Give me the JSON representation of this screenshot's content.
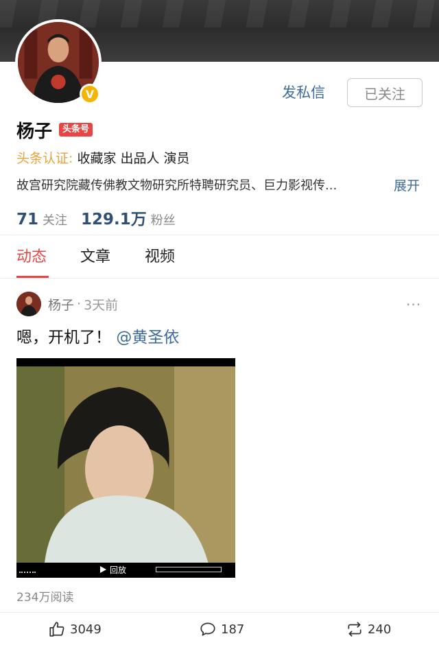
{
  "profile": {
    "name": "杨子",
    "badge": "头条号",
    "message_label": "发私信",
    "follow_label": "已关注",
    "verified_mark": "V",
    "cert_label": "头条认证:",
    "cert_value": "收藏家 出品人 演员",
    "bio": "故宫研究院藏传佛教文物研究所特聘研究员、巨力影视传...",
    "expand_label": "展开",
    "following_count": "71",
    "following_label": "关注",
    "fans_count": "129.1万",
    "fans_label": "粉丝"
  },
  "tabs": [
    {
      "label": "动态",
      "active": true
    },
    {
      "label": "文章",
      "active": false
    },
    {
      "label": "视频",
      "active": false
    }
  ],
  "post": {
    "author": "杨子",
    "separator": "·",
    "time": "3天前",
    "more": "···",
    "text": "嗯，开机了！",
    "mention": "@黄圣依",
    "video_control_label": "回放",
    "reads": "234万阅读",
    "likes": "3049",
    "comments": "187",
    "reposts": "240"
  },
  "colors": {
    "accent_red": "#e84545",
    "link_blue": "#3d6b9b",
    "cert_orange": "#e8a33a",
    "verified_gold": "#f4b400"
  },
  "icons": [
    "thumbs-up-icon",
    "comment-icon",
    "repost-icon",
    "more-icon",
    "play-icon"
  ]
}
